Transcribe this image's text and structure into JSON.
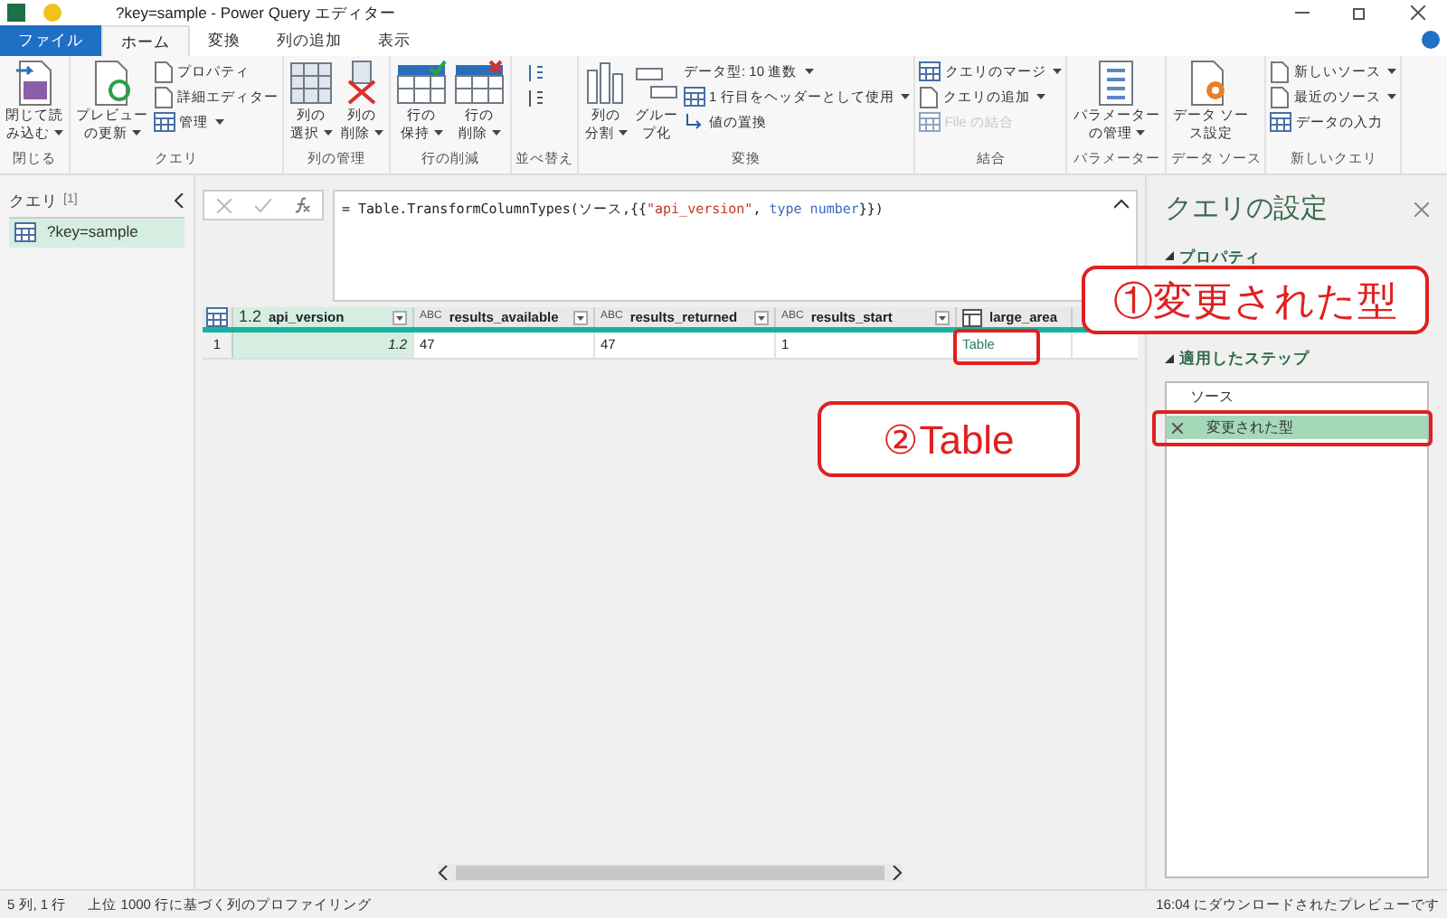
{
  "window": {
    "title": "?key=sample - Power Query エディター"
  },
  "tabs": [
    {
      "label": "ファイル",
      "kind": "file",
      "selected": false
    },
    {
      "label": "ホーム",
      "kind": "tab",
      "selected": true
    },
    {
      "label": "変換",
      "kind": "tab",
      "selected": false
    },
    {
      "label": "列の追加",
      "kind": "tab",
      "selected": false
    },
    {
      "label": "表示",
      "kind": "tab",
      "selected": false
    }
  ],
  "ribbon": {
    "groups": [
      {
        "label": "閉じる",
        "items": [
          {
            "kind": "large",
            "lines": [
              "閉じて読",
              "み込む"
            ],
            "dropdown": true
          }
        ]
      },
      {
        "label": "クエリ",
        "items": [
          {
            "kind": "large",
            "lines": [
              "プレビュー",
              "の更新"
            ],
            "dropdown": true
          },
          {
            "kind": "stack",
            "items": [
              {
                "label": "プロパティ",
                "dropdown": false,
                "disabled": false
              },
              {
                "label": "詳細エディター",
                "dropdown": false,
                "disabled": false
              },
              {
                "label": "管理",
                "dropdown": true,
                "disabled": false
              }
            ]
          }
        ]
      },
      {
        "label": "列の管理",
        "items": [
          {
            "kind": "large",
            "lines": [
              "列の",
              "選択"
            ],
            "dropdown": true
          },
          {
            "kind": "large",
            "lines": [
              "列の",
              "削除"
            ],
            "dropdown": true
          }
        ]
      },
      {
        "label": "行の削減",
        "items": [
          {
            "kind": "large",
            "lines": [
              "行の",
              "保持"
            ],
            "dropdown": true
          },
          {
            "kind": "large",
            "lines": [
              "行の",
              "削除"
            ],
            "dropdown": true
          }
        ]
      },
      {
        "label": "並べ替え",
        "items": [
          {
            "kind": "sort"
          }
        ]
      },
      {
        "label": "変換",
        "items": [
          {
            "kind": "large",
            "lines": [
              "列の",
              "分割"
            ],
            "dropdown": true
          },
          {
            "kind": "large",
            "lines": [
              "グルー",
              "プ化"
            ],
            "dropdown": false
          },
          {
            "kind": "stack",
            "items": [
              {
                "label": "データ型: 10 進数",
                "dropdown": true,
                "disabled": false
              },
              {
                "label": "1 行目をヘッダーとして使用",
                "dropdown": true,
                "disabled": false
              },
              {
                "label": "値の置換",
                "dropdown": false,
                "disabled": false
              }
            ]
          }
        ]
      },
      {
        "label": "結合",
        "items": [
          {
            "kind": "stack",
            "items": [
              {
                "label": "クエリのマージ",
                "dropdown": true,
                "disabled": false
              },
              {
                "label": "クエリの追加",
                "dropdown": true,
                "disabled": false
              },
              {
                "label": "File の結合",
                "dropdown": false,
                "disabled": true
              }
            ]
          }
        ]
      },
      {
        "label": "パラメーター",
        "items": [
          {
            "kind": "large",
            "lines": [
              "パラメーター",
              "の管理"
            ],
            "dropdown": true
          }
        ]
      },
      {
        "label": "データ ソース",
        "items": [
          {
            "kind": "large",
            "lines": [
              "データ ソー",
              "ス設定"
            ],
            "dropdown": false
          }
        ]
      },
      {
        "label": "新しいクエリ",
        "items": [
          {
            "kind": "stack",
            "items": [
              {
                "label": "新しいソース",
                "dropdown": true,
                "disabled": false
              },
              {
                "label": "最近のソース",
                "dropdown": true,
                "disabled": false
              },
              {
                "label": "データの入力",
                "dropdown": false,
                "disabled": false
              }
            ]
          }
        ]
      }
    ]
  },
  "queries": {
    "title": "クエリ",
    "count": "[1]",
    "items": [
      {
        "label": "?key=sample",
        "selected": true
      }
    ]
  },
  "formula": {
    "tokens": [
      {
        "kind": "plain",
        "text": "= Table.TransformColumnTypes(ソース,{{"
      },
      {
        "kind": "string",
        "text": "\"api_version\""
      },
      {
        "kind": "plain",
        "text": ", "
      },
      {
        "kind": "keyword",
        "text": "type number"
      },
      {
        "kind": "plain",
        "text": "}})"
      }
    ]
  },
  "table": {
    "columns": [
      {
        "name": "api_version",
        "kind": "number",
        "type_label": "1.2",
        "selected": true
      },
      {
        "name": "results_available",
        "kind": "text",
        "type_label": "ABC",
        "selected": false
      },
      {
        "name": "results_returned",
        "kind": "text",
        "type_label": "ABC",
        "selected": false
      },
      {
        "name": "results_start",
        "kind": "text",
        "type_label": "ABC",
        "selected": false
      },
      {
        "name": "large_area",
        "kind": "table",
        "selected": false
      }
    ],
    "rows": [
      {
        "index": "1",
        "cells": [
          "1.2",
          "47",
          "47",
          "1",
          "Table"
        ]
      }
    ]
  },
  "settings": {
    "title": "クエリの設定",
    "properties_label": "プロパティ",
    "steps_label": "適用したステップ",
    "steps": [
      {
        "label": "ソース",
        "selected": false
      },
      {
        "label": "変更された型",
        "selected": true
      }
    ]
  },
  "callouts": [
    {
      "text": "①変更された型"
    },
    {
      "text": "②Table"
    }
  ],
  "status_bar": {
    "left": [
      "5 列, 1 行",
      "上位 1000 行に基づく列のプロファイリング"
    ],
    "right": "16:04 にダウンロードされたプレビューです"
  }
}
